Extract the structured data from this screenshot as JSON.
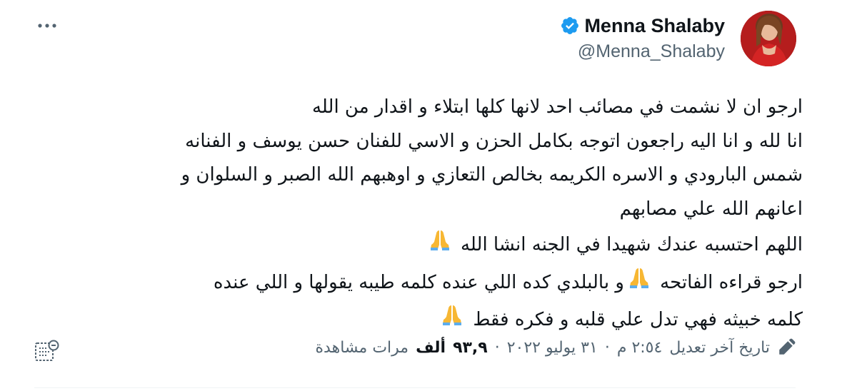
{
  "author": {
    "display_name": "Menna Shalaby",
    "handle": "@Menna_Shalaby",
    "verified": true
  },
  "tweet": {
    "lines": [
      "ارجو ان لا نشمت في مصائب احد لانها كلها ابتلاء و اقدار من الله",
      "انا لله و انا اليه راجعون اتوجه بكامل الحزن و الاسي للفنان حسن يوسف و الفنانه",
      "شمس البارودي و الاسره الكريمه بخالص التعازي و اوهبهم الله الصبر و السلوان و",
      "اعانهم الله علي مصابهم",
      "اللهم احتسبه عندك شهيدا في الجنه انشا الله",
      "ارجو قراءه الفاتحه",
      "و بالبلدي كده اللي عنده كلمه طيبه يقولها و اللي عنده",
      "كلمه خبيثه فهي تدل علي قلبه و فكره فقط"
    ],
    "emoji": "🙏"
  },
  "meta": {
    "edit_note": "تاريخ آخر تعديل",
    "time": "٢:٥٤ م",
    "date": "٣١ يوليو ٢٠٢٢",
    "view_count": "٩٣,٩",
    "view_unit": "ألف",
    "view_label": "مرات مشاهدة",
    "separator": "·"
  },
  "icons": {
    "more": "more-horizontal-icon",
    "verified": "verified-badge-icon",
    "edit": "edit-pencil-icon",
    "analytics": "analytics-icon",
    "pray": "folded-hands-emoji"
  },
  "colors": {
    "verified_blue": "#1d9bf0",
    "secondary_text": "#536471",
    "primary_text": "#0f1419"
  }
}
